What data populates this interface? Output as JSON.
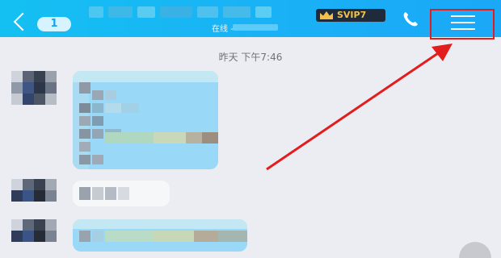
{
  "header": {
    "unread_count": "1",
    "status_label": "在线 -",
    "vip_label": "SVIP7"
  },
  "chat": {
    "timestamp": "昨天 下午7:46"
  },
  "icons": {
    "back": "back-arrow-icon",
    "phone": "phone-icon",
    "menu": "menu-icon",
    "crown": "crown-icon"
  },
  "colors": {
    "header_start": "#14c0f2",
    "header_end": "#1aa8f7",
    "bubble": "#9ad8f8",
    "annotation": "#e21d1d"
  }
}
